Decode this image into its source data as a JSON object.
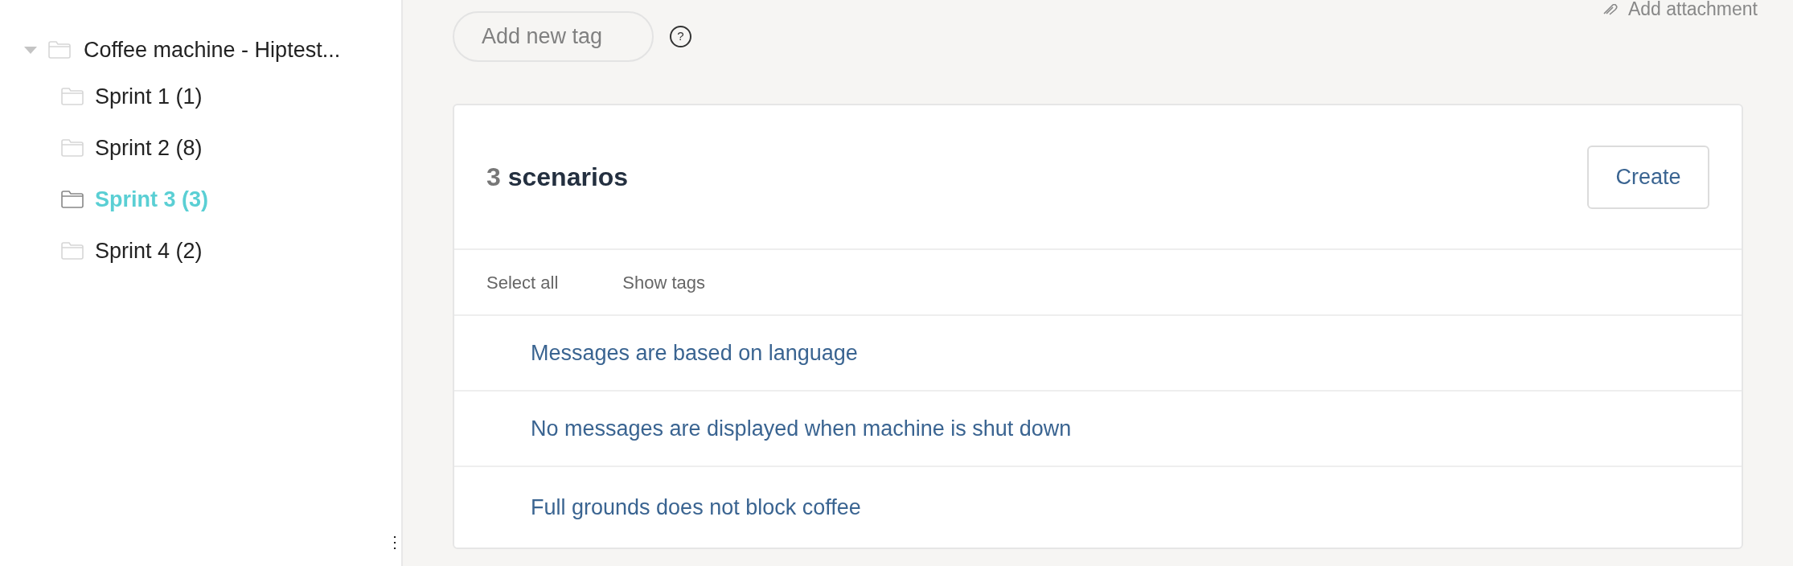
{
  "tree": {
    "label": "Coffee machine - Hiptest...",
    "expanded": true,
    "children": [
      {
        "label": "Sprint 1 (1)",
        "selected": false
      },
      {
        "label": "Sprint 2 (8)",
        "selected": false
      },
      {
        "label": "Sprint 3 (3)",
        "selected": true
      },
      {
        "label": "Sprint 4 (2)",
        "selected": false
      }
    ]
  },
  "resize_handle": "⋮",
  "tag_field": {
    "placeholder": "Add new tag"
  },
  "help": "?",
  "attachment_link": "Add attachment",
  "scenarios": {
    "count": "3",
    "title": "scenarios",
    "create_button": "Create",
    "actions": [
      "Select all",
      "Show tags"
    ],
    "rows": [
      "Messages are based on language",
      "No messages are displayed when machine is shut down",
      "Full grounds does not block coffee"
    ]
  }
}
